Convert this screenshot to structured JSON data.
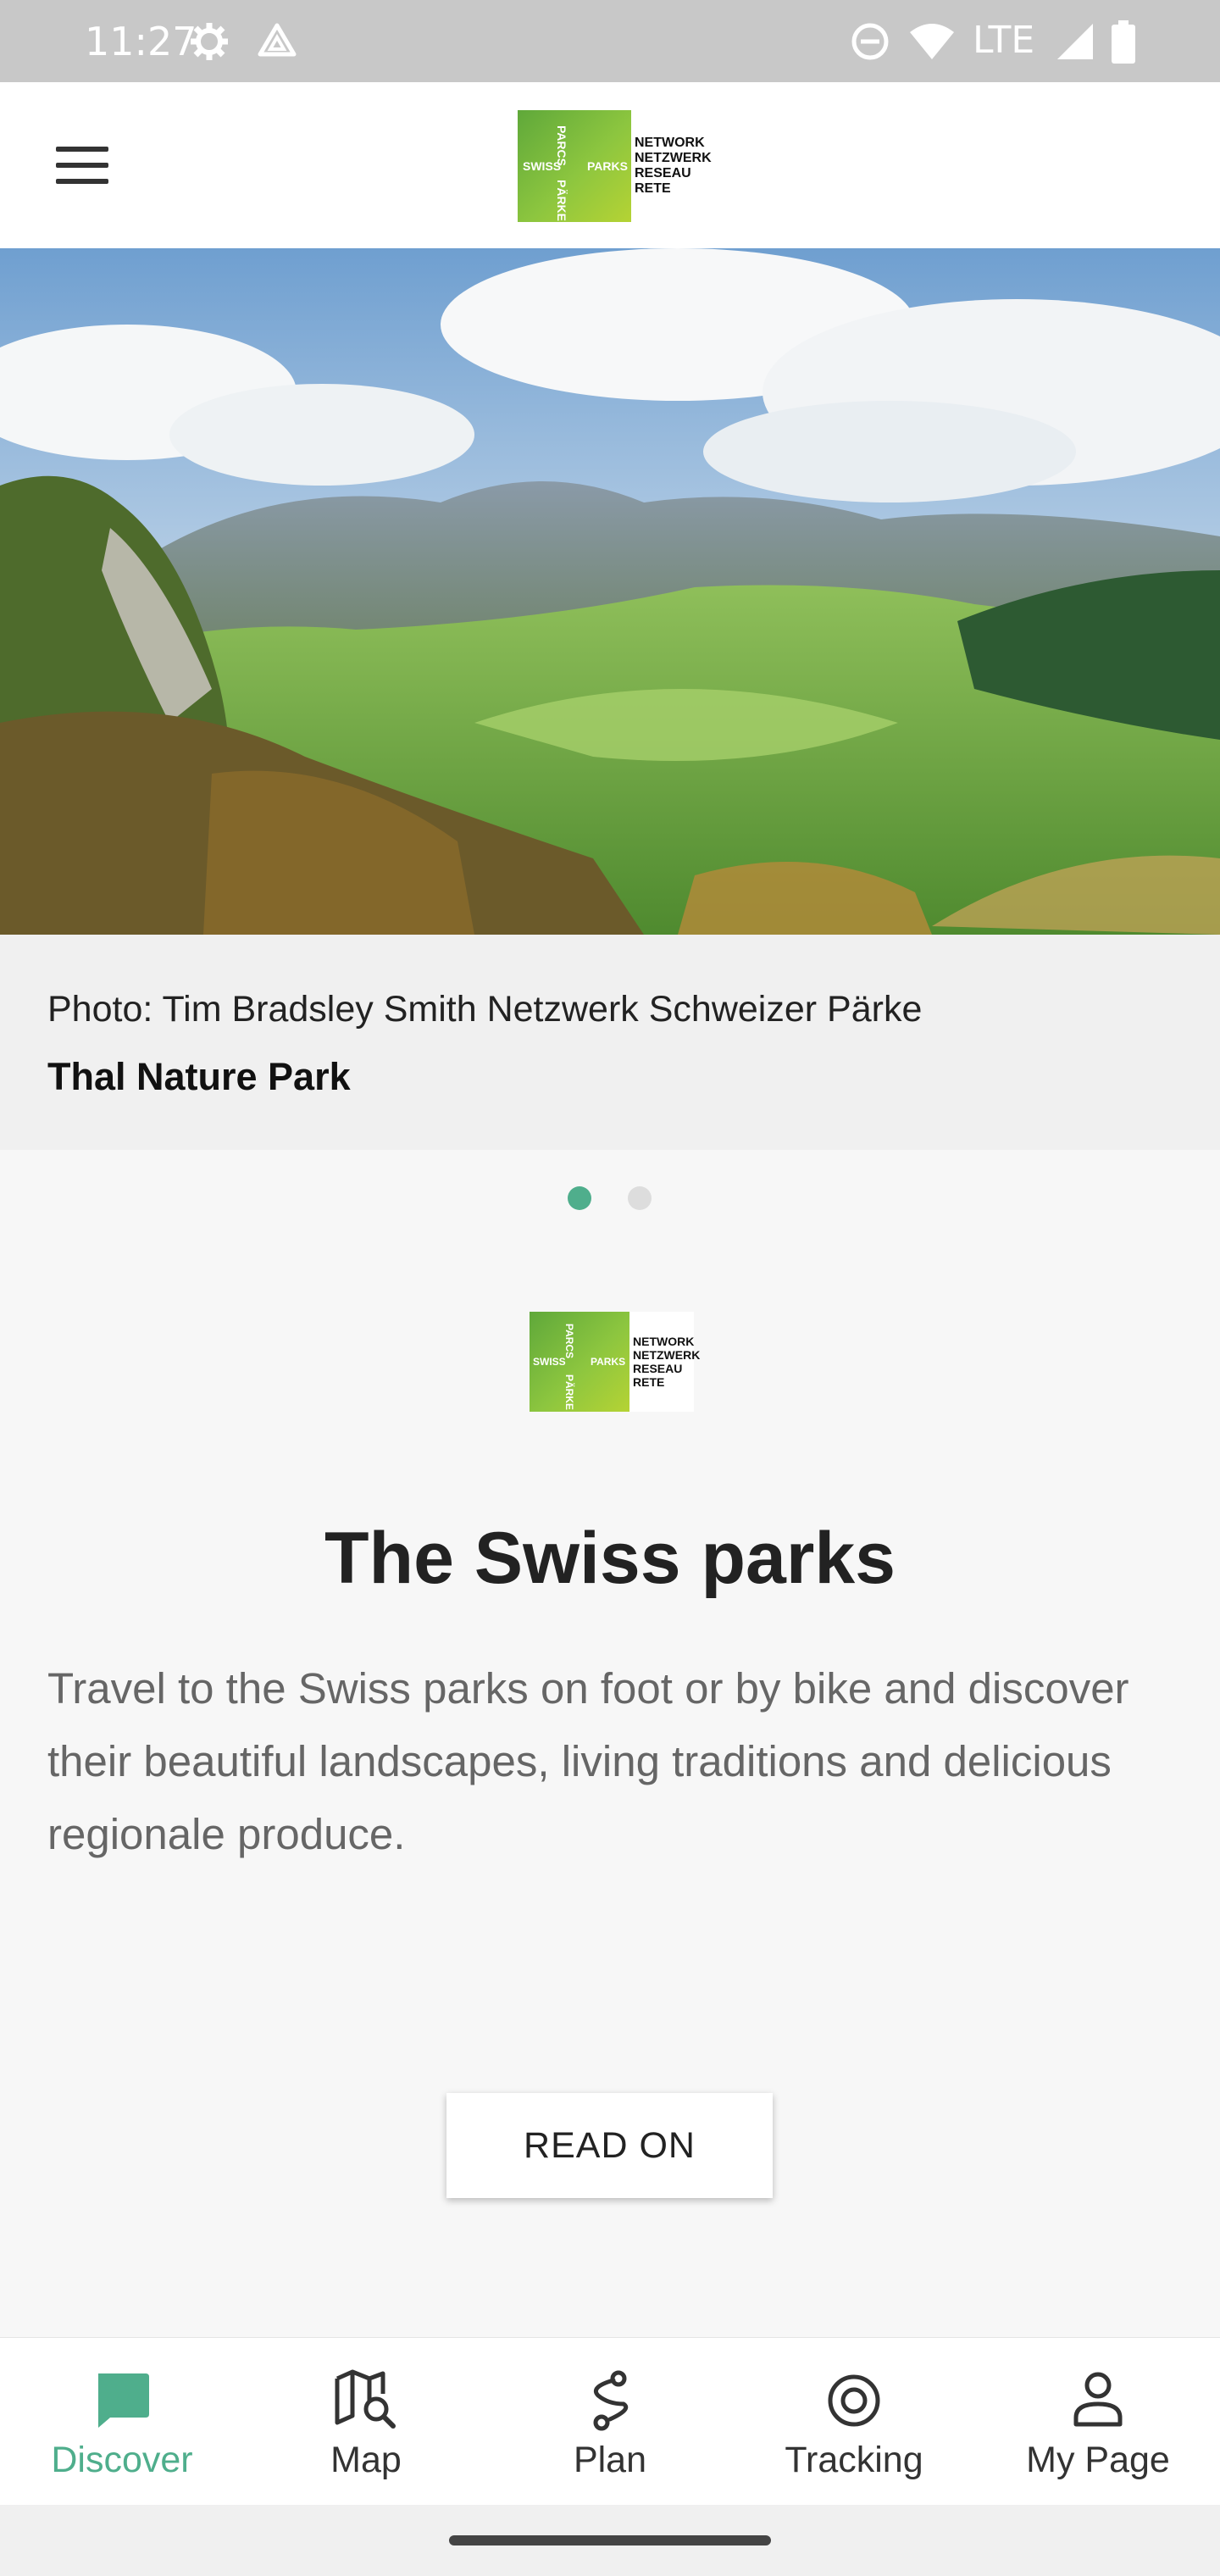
{
  "status_bar": {
    "time": "11:27",
    "network": "LTE",
    "icons": [
      "settings-gear-icon",
      "drive-triangle-icon",
      "do-not-disturb-icon",
      "wifi-icon",
      "signal-icon",
      "battery-icon"
    ]
  },
  "header": {
    "menu_icon": "hamburger-menu-icon",
    "logo": {
      "green_words": [
        "SWISS",
        "PARCS",
        "PARKS",
        "PÄRKE"
      ],
      "white_words": [
        "NETWORK",
        "NETZWERK",
        "RESEAU",
        "RETE"
      ]
    }
  },
  "hero": {
    "photo_credit": "Photo: Tim Bradsley Smith Netzwerk Schweizer Pärke",
    "park_name": "Thal Nature Park",
    "slides": 2,
    "active_slide": 1
  },
  "content": {
    "logo": {
      "green_words": [
        "SWISS",
        "PARCS",
        "PARKS",
        "PÄRKE"
      ],
      "white_words": [
        "NETWORK",
        "NETZWERK",
        "RESEAU",
        "RETE"
      ]
    },
    "title": "The Swiss parks",
    "description": "Travel to the Swiss parks on foot or by bike and discover their beautiful landscapes, living traditions and delicious regionale produce.",
    "button_label": "READ ON"
  },
  "bottom_nav": {
    "items": [
      {
        "label": "Discover",
        "icon": "discover-chat-icon",
        "active": true
      },
      {
        "label": "Map",
        "icon": "map-search-icon",
        "active": false
      },
      {
        "label": "Plan",
        "icon": "route-plan-icon",
        "active": false
      },
      {
        "label": "Tracking",
        "icon": "target-tracking-icon",
        "active": false
      },
      {
        "label": "My Page",
        "icon": "user-profile-icon",
        "active": false
      }
    ]
  },
  "colors": {
    "accent": "#4fae8c",
    "status_bar": "#c8c8c8",
    "dot_inactive": "#dddddd"
  }
}
